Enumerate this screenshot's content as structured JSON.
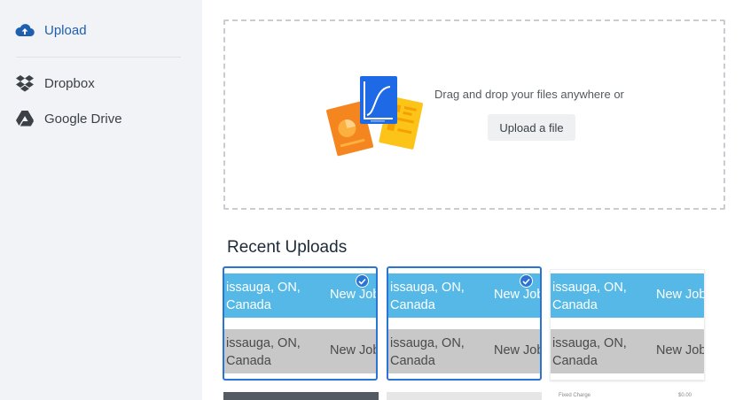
{
  "sidebar": {
    "items": [
      {
        "label": "Upload",
        "icon": "cloud-upload-icon",
        "active": true
      },
      {
        "label": "Dropbox",
        "icon": "dropbox-icon",
        "active": false
      },
      {
        "label": "Google Drive",
        "icon": "google-drive-icon",
        "active": false
      }
    ]
  },
  "dropzone": {
    "instruction": "Drag and drop your files anywhere or",
    "button_label": "Upload a file"
  },
  "recent": {
    "title": "Recent Uploads",
    "items": [
      {
        "line1": "issauga, ON,",
        "line2": "Canada",
        "job": "New Job",
        "selected": true
      },
      {
        "line1": "issauga, ON,",
        "line2": "Canada",
        "job": "New Job",
        "selected": true
      },
      {
        "line1": "issauga, ON,",
        "line2": "Canada",
        "job": "New Job",
        "selected": false
      }
    ],
    "partial_row": {
      "label": "Fixed Charge",
      "amount": "$0.00"
    }
  },
  "colors": {
    "accent": "#2a74d4",
    "sidebar_bg": "#f1f3f6",
    "thumb_blue": "#55b8e6",
    "thumb_gray": "#c8c8c8"
  }
}
